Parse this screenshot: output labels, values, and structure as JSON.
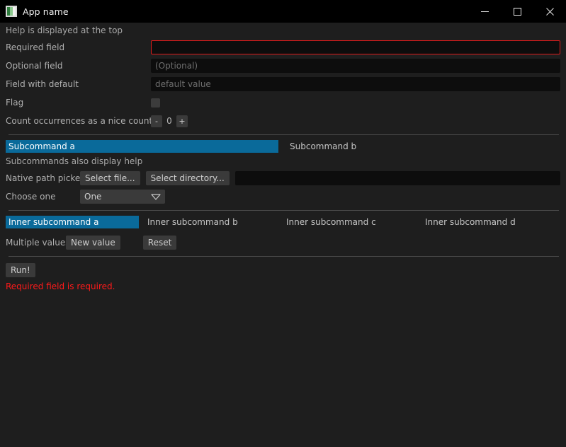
{
  "window": {
    "title": "App name",
    "icon": "app-window-icon",
    "controls": {
      "minimize": "minimize-icon",
      "maximize": "maximize-icon",
      "close": "close-icon"
    }
  },
  "colors": {
    "background": "#1e1e1e",
    "titlebar": "#000000",
    "accent": "#0a6a9a",
    "error": "#ff1a1a",
    "input_bg": "#0d0d0d",
    "button_bg": "#3a3a3a",
    "separator": "#4a4a4a",
    "required_border": "#e01b1b"
  },
  "help_top": "Help is displayed at the top",
  "fields": {
    "required": {
      "label": "Required field",
      "value": "",
      "placeholder": ""
    },
    "optional": {
      "label": "Optional field",
      "value": "",
      "placeholder": "(Optional)"
    },
    "with_default": {
      "label": "Field with default",
      "value": "",
      "placeholder": "default value"
    },
    "flag": {
      "label": "Flag",
      "checked": false
    },
    "counter": {
      "label": "Count occurrences as a nice counter",
      "decrement": "-",
      "value": "0",
      "increment": "+"
    }
  },
  "subcommands": {
    "tabs": [
      {
        "label": "Subcommand a",
        "active": true
      },
      {
        "label": "Subcommand b",
        "active": false
      }
    ],
    "help": "Subcommands also display help"
  },
  "path_picker": {
    "label": "Native path picker",
    "select_file": "Select file...",
    "select_directory": "Select directory...",
    "value": "",
    "placeholder": ""
  },
  "choose_one": {
    "label": "Choose one",
    "selected": "One",
    "options": [
      "One"
    ],
    "chevron": "chevron-down-icon"
  },
  "inner_subcommands": {
    "tabs": [
      {
        "label": "Inner subcommand a",
        "active": true
      },
      {
        "label": "Inner subcommand b",
        "active": false
      },
      {
        "label": "Inner subcommand c",
        "active": false
      },
      {
        "label": "Inner subcommand d",
        "active": false
      }
    ]
  },
  "multiple_values": {
    "label": "Multiple values",
    "new_value": "New value",
    "reset": "Reset"
  },
  "run": {
    "label": "Run!"
  },
  "validation": {
    "message": "Required field is required."
  }
}
